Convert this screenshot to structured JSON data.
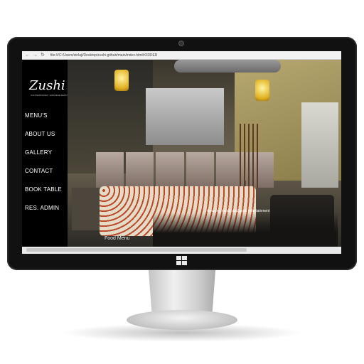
{
  "browser": {
    "url": "file:///C:/Users/zinlaji/Desktop/zushi-github/main/index.html#ORDER"
  },
  "site": {
    "logo_text": "Zushi",
    "logo_tagline": "CONTEMPORARY JAPANESE RESTAURANT"
  },
  "menu": {
    "items": [
      {
        "label": "MENU'S"
      },
      {
        "label": "ABOUT US"
      },
      {
        "label": "GALLERY"
      },
      {
        "label": "CONTACT"
      },
      {
        "label": "BOOK TABLE"
      },
      {
        "label": "RES. ADMIN"
      }
    ]
  },
  "hero": {
    "caption": "Amazing meals and good entertainment",
    "food_label": "Food Menu"
  },
  "colors": {
    "sidebar_bg": "#000000",
    "menu_text": "#ffffff",
    "lamp": "#e0b020"
  },
  "icons": {
    "back": "back-arrow-icon",
    "forward": "forward-arrow-icon",
    "reload": "reload-icon",
    "windows": "windows-logo-icon"
  }
}
